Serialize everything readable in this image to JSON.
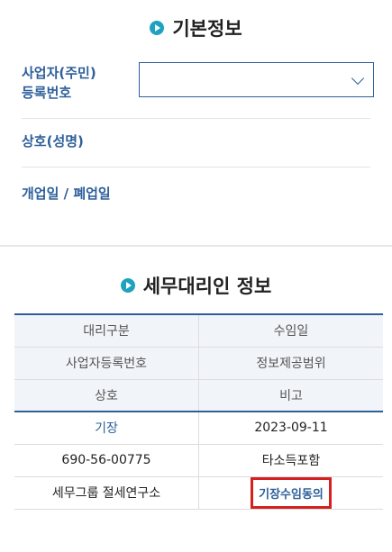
{
  "basic_info": {
    "title": "기본정보",
    "bizno_label": "사업자(주민)\n등록번호",
    "bizno_value": "",
    "name_label": "상호(성명)",
    "date_label": "개업일 / 폐업일"
  },
  "agent_info": {
    "title": "세무대리인 정보",
    "headers": [
      [
        "대리구분",
        "수임일"
      ],
      [
        "사업자등록번호",
        "정보제공범위"
      ],
      [
        "상호",
        "비고"
      ]
    ],
    "rows": [
      [
        "기장",
        "2023-09-11"
      ],
      [
        "690-56-00775",
        "타소득포함"
      ],
      [
        "세무그룹 절세연구소",
        "기장수임동의"
      ]
    ]
  }
}
